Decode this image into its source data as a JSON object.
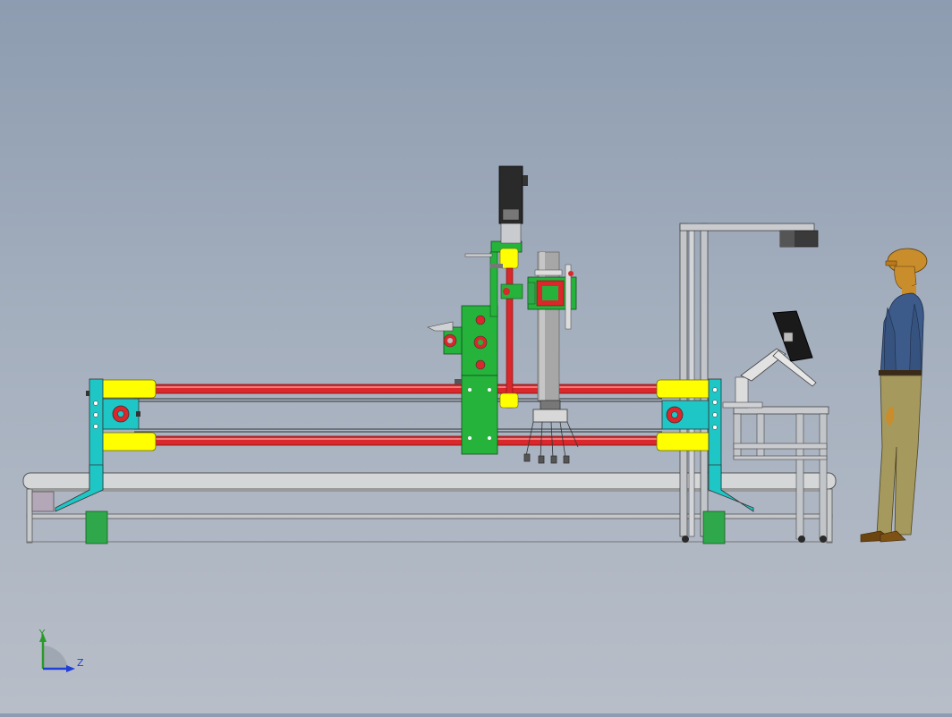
{
  "viewport": {
    "background_top": "#8d9cb0",
    "background_bottom": "#b8bec8"
  },
  "colors": {
    "rail": "#d9272b",
    "bearing": "#ffff00",
    "carriage": "#25b33c",
    "end_plate": "#1ec6c6",
    "foot": "#2ea84a",
    "motor": "#2a2a2a",
    "column": "#a7a7a7",
    "frame": "#b9bcc1",
    "helmet": "#c98d2b",
    "shirt": "#3c5a8a",
    "trousers": "#a6995e"
  },
  "triad": {
    "y_label": "Y",
    "z_label": "Z",
    "y_color": "#2a9b2a",
    "z_color": "#1f3fd6"
  },
  "icons": {
    "triad": "axis-triad-icon",
    "human": "human-figure-icon",
    "monitor": "monitor-icon"
  }
}
